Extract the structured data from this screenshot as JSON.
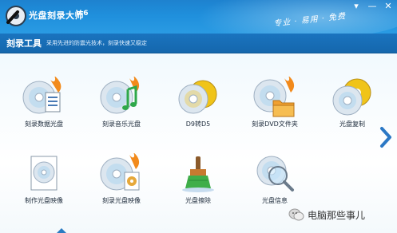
{
  "window": {
    "title": "光盘刻录大师",
    "version": "V.6",
    "slogan": "专业 · 易用 · 免费",
    "controls": [
      "▾",
      "—",
      "✕"
    ]
  },
  "toolbar": {
    "title": "刻录工具",
    "description": "采用先进的防震光技术，刻录快速又稳定"
  },
  "items_row1": [
    {
      "label": "刻录数据光盘",
      "icon": "data-disc-burn-icon"
    },
    {
      "label": "刻录音乐光盘",
      "icon": "music-disc-burn-icon"
    },
    {
      "label": "D9转D5",
      "icon": "d9-to-d5-icon"
    },
    {
      "label": "刻录DVD文件夹",
      "icon": "dvd-folder-burn-icon"
    },
    {
      "label": "光盘复制",
      "icon": "disc-copy-icon"
    }
  ],
  "items_row2": [
    {
      "label": "制作光盘映像",
      "icon": "make-image-icon"
    },
    {
      "label": "刻录光盘映像",
      "icon": "burn-image-icon"
    },
    {
      "label": "光盘擦除",
      "icon": "disc-erase-icon"
    },
    {
      "label": "光盘信息",
      "icon": "disc-info-icon"
    }
  ],
  "watermark": {
    "text": "电脑那些事儿"
  },
  "colors": {
    "accent": "#1f8fdc",
    "toolbar": "#1567ad",
    "flame": "#f28a1b"
  }
}
